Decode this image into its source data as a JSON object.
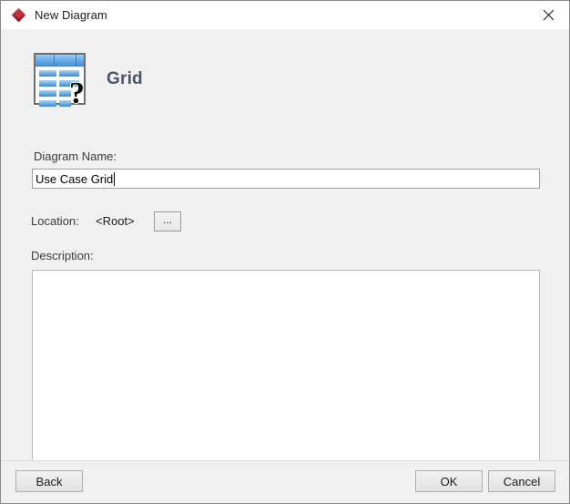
{
  "window": {
    "title": "New Diagram",
    "icon": "red-diamond-icon",
    "close_label": "✕"
  },
  "header": {
    "icon": "grid-table-question-icon",
    "title": "Grid"
  },
  "form": {
    "name_label": "Diagram Name:",
    "name_value": "Use Case Grid",
    "name_placeholder": "",
    "location_label": "Location:",
    "location_value": "<Root>",
    "browse_label": "...",
    "description_label": "Description:",
    "description_value": "",
    "description_placeholder": ""
  },
  "footer": {
    "back_label": "Back",
    "ok_label": "OK",
    "cancel_label": "Cancel"
  },
  "colors": {
    "dialog_bg": "#f0f0f0",
    "titlebar_bg": "#ffffff",
    "accent_red": "#b01f2c",
    "grid_blue": "#62a9e6",
    "title_text": "#4a5568"
  }
}
